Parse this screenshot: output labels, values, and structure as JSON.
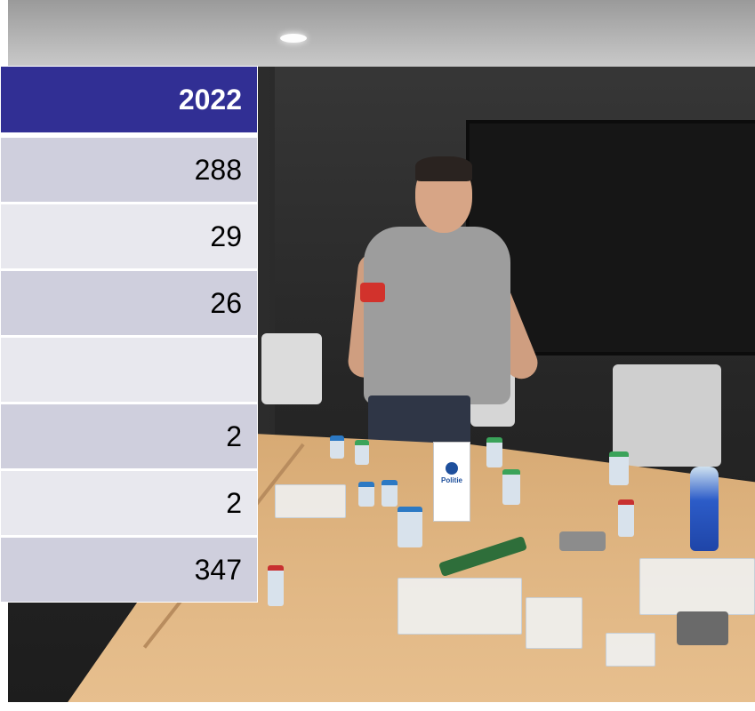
{
  "table": {
    "header": "2022",
    "rows": [
      {
        "value": "288",
        "shade": "dark"
      },
      {
        "value": "29",
        "shade": "light"
      },
      {
        "value": "26",
        "shade": "dark"
      },
      {
        "value": "",
        "shade": "light"
      },
      {
        "value": "2",
        "shade": "dark"
      },
      {
        "value": "2",
        "shade": "light"
      },
      {
        "value": "347",
        "shade": "dark"
      }
    ]
  },
  "photo": {
    "sign_text": "Politie",
    "colors": {
      "header_bg": "#312f94",
      "row_dark": "#cfcfdd",
      "row_light": "#e8e8ee"
    }
  }
}
